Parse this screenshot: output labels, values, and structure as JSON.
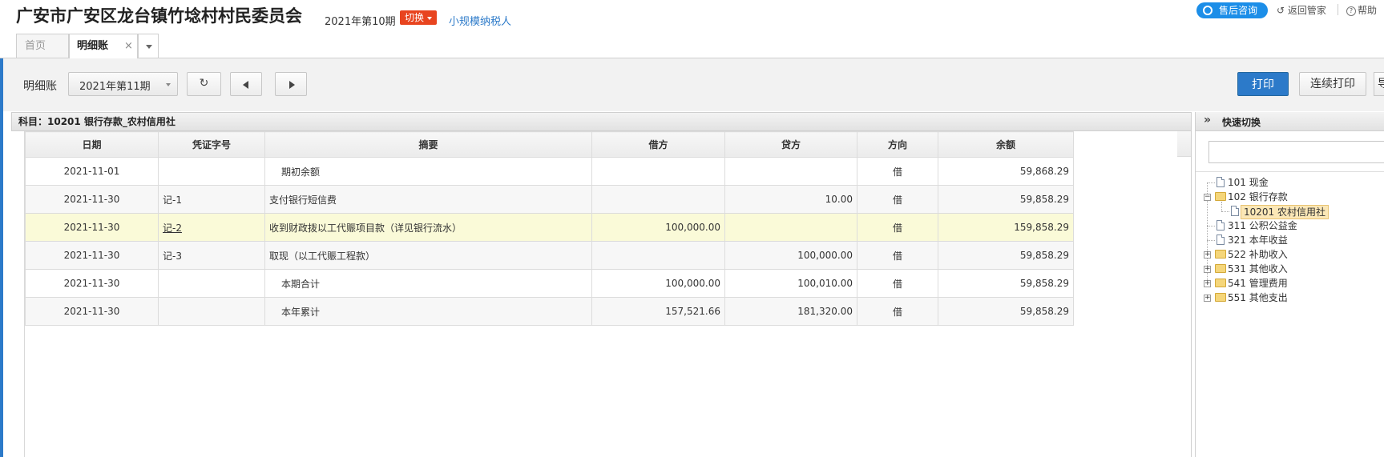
{
  "header": {
    "org_name": "广安市广安区龙台镇竹埝村村民委员会",
    "period_text": "2021年第10期",
    "switch_label": "切换",
    "taxpayer_type": "小规模纳税人",
    "consult_label": "售后咨询",
    "back_label": "返回管家",
    "help_label": "帮助"
  },
  "tabs": {
    "home": "首页",
    "ledger": "明细账",
    "close": "×"
  },
  "toolbar": {
    "label": "明细账",
    "period_value": "2021年第11期",
    "print_label": "打印",
    "continuous_print_label": "连续打印",
    "cut_label": "导"
  },
  "subject": {
    "text": "科目：10201 银行存款_农村信用社"
  },
  "table": {
    "headers": [
      "日期",
      "凭证字号",
      "摘要",
      "借方",
      "贷方",
      "方向",
      "余额"
    ],
    "rows": [
      {
        "date": "2021-11-01",
        "voucher": "",
        "summary": "期初余额",
        "debit": "",
        "credit": "",
        "dir": "借",
        "balance": "59,868.29"
      },
      {
        "date": "2021-11-30",
        "voucher": "记-1",
        "summary": "支付银行短信费",
        "debit": "",
        "credit": "10.00",
        "dir": "借",
        "balance": "59,858.29"
      },
      {
        "date": "2021-11-30",
        "voucher": "记-2",
        "summary": "收到财政拨以工代赈项目款（详见银行流水）",
        "debit": "100,000.00",
        "credit": "",
        "dir": "借",
        "balance": "159,858.29"
      },
      {
        "date": "2021-11-30",
        "voucher": "记-3",
        "summary": "取现（以工代赈工程款）",
        "debit": "",
        "credit": "100,000.00",
        "dir": "借",
        "balance": "59,858.29"
      },
      {
        "date": "2021-11-30",
        "voucher": "",
        "summary": "本期合计",
        "debit": "100,000.00",
        "credit": "100,010.00",
        "dir": "借",
        "balance": "59,858.29"
      },
      {
        "date": "2021-11-30",
        "voucher": "",
        "summary": "本年累计",
        "debit": "157,521.66",
        "credit": "181,320.00",
        "dir": "借",
        "balance": "59,858.29"
      }
    ]
  },
  "quick_switch": {
    "title": "快速切换",
    "tree": [
      {
        "label": "101 现金"
      },
      {
        "label": "102 银行存款"
      },
      {
        "label": "10201 农村信用社"
      },
      {
        "label": "311 公积公益金"
      },
      {
        "label": "321 本年收益"
      },
      {
        "label": "522 补助收入"
      },
      {
        "label": "531 其他收入"
      },
      {
        "label": "541 管理费用"
      },
      {
        "label": "551 其他支出"
      }
    ]
  },
  "colors": {
    "accent": "#2c7ac9",
    "switch_badge": "#e8441f",
    "highlight_row": "#fafad8"
  }
}
